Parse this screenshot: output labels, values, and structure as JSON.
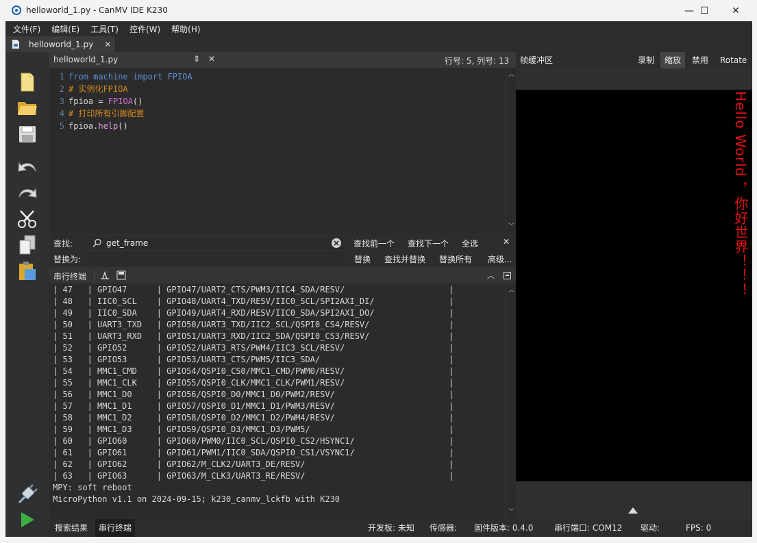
{
  "window": {
    "title": "helloworld_1.py - CanMV IDE K230",
    "minimize": "—",
    "maximize": "☐",
    "close": "✕"
  },
  "menu": [
    "文件(F)",
    "编辑(E)",
    "工具(T)",
    "控件(W)",
    "帮助(H)"
  ],
  "file_tab": {
    "label": "helloworld_1.py",
    "close": "✕"
  },
  "editor": {
    "filename": "helloworld_1.py",
    "cursor": "行号: 5, 列号: 13",
    "lines": [
      {
        "n": "1",
        "parts": [
          [
            "kw",
            "from"
          ],
          [
            "txt",
            " "
          ],
          [
            "kw",
            "machine"
          ],
          [
            "txt",
            " "
          ],
          [
            "kw",
            "import"
          ],
          [
            "txt",
            " "
          ],
          [
            "kw",
            "FPIOA"
          ]
        ]
      },
      {
        "n": "2",
        "parts": [
          [
            "cm",
            "# 实例化FPIOA"
          ]
        ]
      },
      {
        "n": "3",
        "parts": [
          [
            "txt",
            "fpioa = "
          ],
          [
            "cls",
            "FPIOA"
          ],
          [
            "txt",
            "()"
          ]
        ]
      },
      {
        "n": "4",
        "parts": [
          [
            "cm",
            "# 打印所有引脚配置"
          ]
        ]
      },
      {
        "n": "5",
        "parts": [
          [
            "txt",
            "fpioa."
          ],
          [
            "fn",
            "help"
          ],
          [
            "txt",
            "()"
          ]
        ]
      }
    ]
  },
  "find": {
    "find_label": "查找:",
    "replace_label": "替换为:",
    "search_value": "get_frame",
    "find_prev": "查找前一个",
    "find_next": "查找下一个",
    "select_all": "全选",
    "replace": "替换",
    "find_replace": "查找并替换",
    "replace_all": "替换所有",
    "advanced": "高级..."
  },
  "terminal": {
    "label": "串行终端",
    "rows": [
      [
        "47",
        "GPIO47",
        "GPIO47/UART2_CTS/PWM3/IIC4_SDA/RESV/"
      ],
      [
        "48",
        "IIC0_SCL",
        "GPIO48/UART4_TXD/RESV/IIC0_SCL/SPI2AXI_DI/"
      ],
      [
        "49",
        "IIC0_SDA",
        "GPIO49/UART4_RXD/RESV/IIC0_SDA/SPI2AXI_DO/"
      ],
      [
        "50",
        "UART3_TXD",
        "GPIO50/UART3_TXD/IIC2_SCL/QSPI0_CS4/RESV/"
      ],
      [
        "51",
        "UART3_RXD",
        "GPIO51/UART3_RXD/IIC2_SDA/QSPI0_CS3/RESV/"
      ],
      [
        "52",
        "GPIO52",
        "GPIO52/UART3_RTS/PWM4/IIC3_SCL/RESV/"
      ],
      [
        "53",
        "GPIO53",
        "GPIO53/UART3_CTS/PWM5/IIC3_SDA/"
      ],
      [
        "54",
        "MMC1_CMD",
        "GPIO54/QSPI0_CS0/MMC1_CMD/PWM0/RESV/"
      ],
      [
        "55",
        "MMC1_CLK",
        "GPIO55/QSPI0_CLK/MMC1_CLK/PWM1/RESV/"
      ],
      [
        "56",
        "MMC1_D0",
        "GPIO56/QSPI0_D0/MMC1_D0/PWM2/RESV/"
      ],
      [
        "57",
        "MMC1_D1",
        "GPIO57/QSPI0_D1/MMC1_D1/PWM3/RESV/"
      ],
      [
        "58",
        "MMC1_D2",
        "GPIO58/QSPI0_D2/MMC1_D2/PWM4/RESV/"
      ],
      [
        "59",
        "MMC1_D3",
        "GPIO59/QSPI0_D3/MMC1_D3/PWM5/"
      ],
      [
        "60",
        "GPIO60",
        "GPIO60/PWM0/IIC0_SCL/QSPI0_CS2/HSYNC1/"
      ],
      [
        "61",
        "GPIO61",
        "GPIO61/PWM1/IIC0_SDA/QSPI0_CS1/VSYNC1/"
      ],
      [
        "62",
        "GPIO62",
        "GPIO62/M_CLK2/UART3_DE/RESV/"
      ],
      [
        "63",
        "GPIO63",
        "GPIO63/M_CLK3/UART3_RE/RESV/"
      ]
    ],
    "msg1": "MPY: soft reboot",
    "msg2": "MicroPython v1.1 on 2024-09-15; k230_canmv_lckfb with K230"
  },
  "framebuffer": {
    "label": "帧缓冲区",
    "record": "录制",
    "zoom": "缩放",
    "disable": "禁用",
    "rotate": "Rotate",
    "overlay_text": "Hello World ，你好世界！！！"
  },
  "status": {
    "search_results": "搜索结果",
    "serial_terminal": "串行终端",
    "board": "开发板: 未知",
    "sensor": "传感器:",
    "firmware": "固件版本: 0.4.0",
    "port": "串行端口: COM12",
    "driver": "驱动:",
    "fps": "FPS: 0"
  }
}
